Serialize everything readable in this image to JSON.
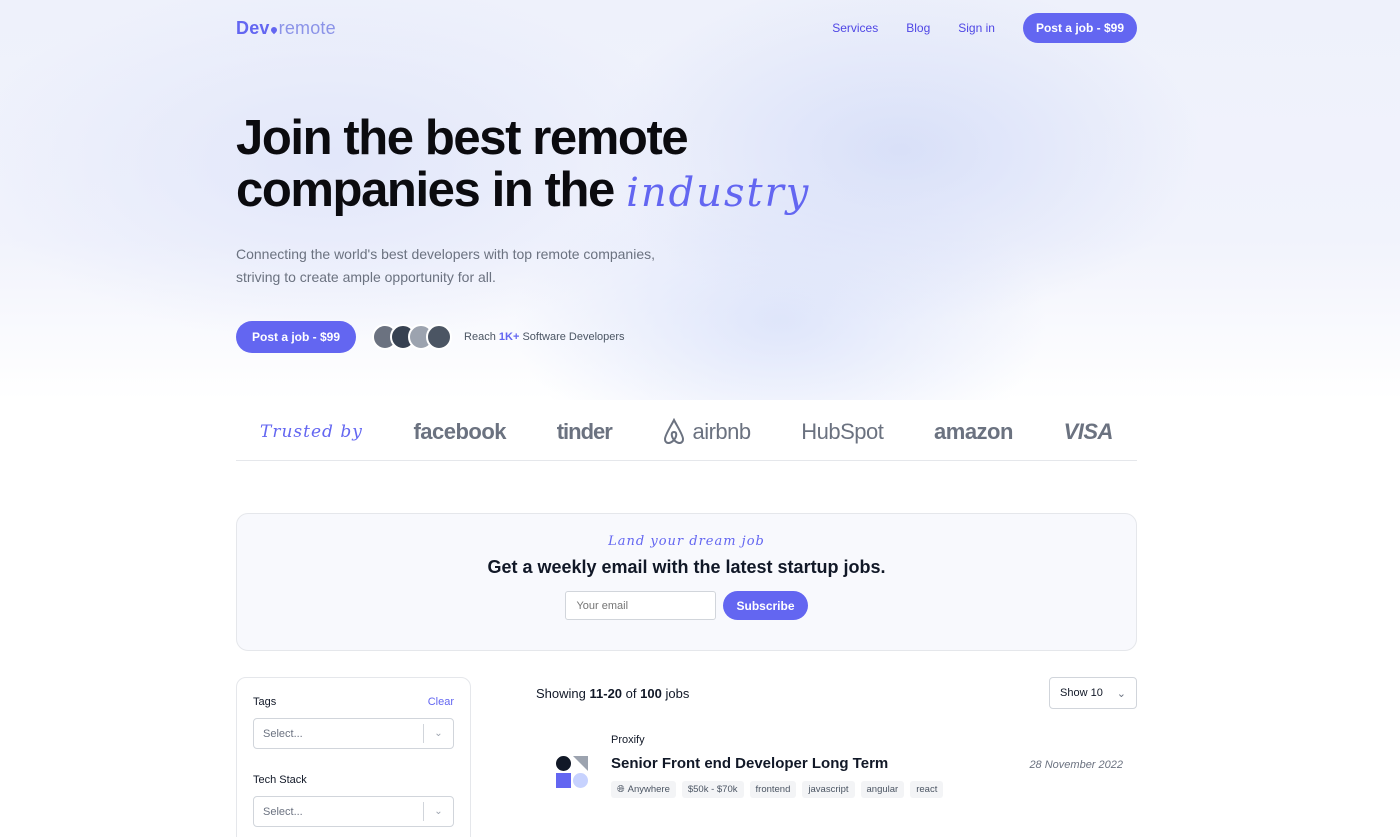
{
  "header": {
    "logo_part1": "Dev",
    "logo_part2": "remote",
    "nav": [
      "Services",
      "Blog",
      "Sign in"
    ],
    "cta": "Post a job - $99"
  },
  "hero": {
    "headline_line1": "Join the best remote",
    "headline_line2": "companies in the",
    "headline_script": "industry",
    "subtitle_line1": "Connecting the world's best developers with top remote companies,",
    "subtitle_line2": "striving to create ample opportunity for all.",
    "cta": "Post a job - $99",
    "reach_prefix": "Reach",
    "reach_count": "1K+",
    "reach_suffix": "Software Developers",
    "avatar_colors": [
      "#6b7280",
      "#374151",
      "#9ca3af",
      "#4b5563"
    ]
  },
  "trusted": {
    "label": "Trusted by",
    "brands": [
      "facebook",
      "tinder",
      "airbnb",
      "HubSpot",
      "amazon",
      "VISA"
    ]
  },
  "newsletter": {
    "tagline": "Land your dream job",
    "title": "Get a weekly email with the latest startup jobs.",
    "email_placeholder": "Your email",
    "subscribe": "Subscribe"
  },
  "filters": {
    "tags_label": "Tags",
    "clear": "Clear",
    "tags_placeholder": "Select...",
    "stack_label": "Tech Stack",
    "stack_placeholder": "Select..."
  },
  "listing": {
    "showing_prefix": "Showing",
    "range": "11-20",
    "of": "of",
    "total": "100",
    "jobs_word": "jobs",
    "show_select": "Show 10",
    "jobs": [
      {
        "company": "Proxify",
        "title": "Senior Front end Developer Long Term",
        "date": "28 November 2022",
        "location": "Anywhere",
        "tags": [
          "$50k - $70k",
          "frontend",
          "javascript",
          "angular",
          "react"
        ]
      }
    ]
  },
  "colors": {
    "accent": "#6366f1",
    "text": "#111827",
    "muted": "#6b7280"
  }
}
